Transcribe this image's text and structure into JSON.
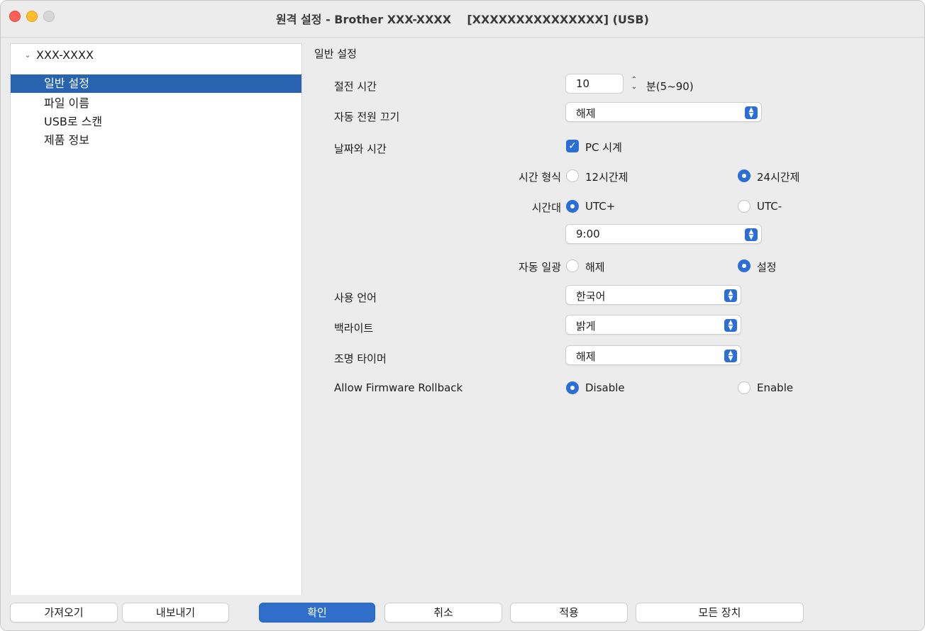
{
  "window": {
    "title": "원격 설정 - Brother XXX-XXXX    [XXXXXXXXXXXXXXX] (USB)"
  },
  "sidebar": {
    "root": "XXX-XXXX",
    "items": [
      {
        "label": "일반 설정",
        "selected": true
      },
      {
        "label": "파일 이름",
        "selected": false
      },
      {
        "label": "USB로 스캔",
        "selected": false
      },
      {
        "label": "제품 정보",
        "selected": false
      }
    ]
  },
  "panel": {
    "section_title": "일반 설정",
    "sleep_time": {
      "label": "절전 시간",
      "value": "10",
      "unit": "분(5~90)"
    },
    "auto_power_off": {
      "label": "자동 전원 끄기",
      "value": "해제"
    },
    "date_time": {
      "label": "날짜와 시간",
      "pc_clock_label": "PC 시계",
      "pc_clock_checked": true
    },
    "time_format": {
      "label": "시간 형식",
      "options": [
        "12시간제",
        "24시간제"
      ],
      "selected": "24시간제"
    },
    "time_zone": {
      "label": "시간대",
      "options": [
        "UTC+",
        "UTC-"
      ],
      "selected": "UTC+",
      "value": "9:00"
    },
    "auto_dst": {
      "label": "자동 일광",
      "options": [
        "해제",
        "설정"
      ],
      "selected": "설정"
    },
    "language": {
      "label": "사용 언어",
      "value": "한국어"
    },
    "backlight": {
      "label": "백라이트",
      "value": "밝게"
    },
    "dim_timer": {
      "label": "조명 타이머",
      "value": "해제"
    },
    "firmware_rollback": {
      "label": "Allow Firmware Rollback",
      "options": [
        "Disable",
        "Enable"
      ],
      "selected": "Disable"
    }
  },
  "buttons": {
    "import": "가져오기",
    "export": "내보내기",
    "ok": "확인",
    "cancel": "취소",
    "apply": "적용",
    "all_devices": "모든 장치"
  },
  "colors": {
    "accent": "#2b6fd6",
    "selection": "#2863b0",
    "close": "#fe5f57",
    "minimize": "#febc2e"
  }
}
